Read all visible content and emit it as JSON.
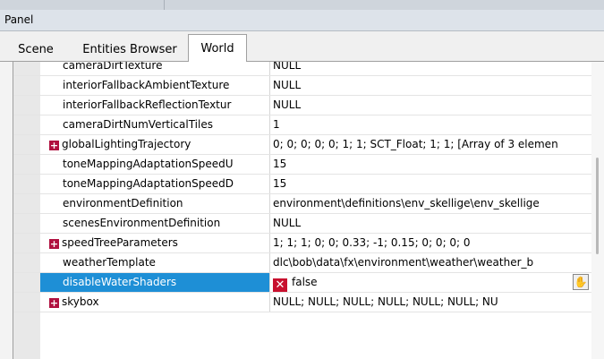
{
  "panel": {
    "title": "Panel"
  },
  "tabs": [
    {
      "label": "Scene"
    },
    {
      "label": "Entities Browser"
    },
    {
      "label": "World",
      "active": true
    }
  ],
  "properties": [
    {
      "name": "cameraDirtTexture",
      "value": "NULL",
      "expandable": false
    },
    {
      "name": "interiorFallbackAmbientTexture",
      "value": "NULL",
      "expandable": false
    },
    {
      "name": "interiorFallbackReflectionTextur",
      "value": "NULL",
      "expandable": false
    },
    {
      "name": "cameraDirtNumVerticalTiles",
      "value": "1",
      "expandable": false
    },
    {
      "name": "globalLightingTrajectory",
      "value": "0; 0; 0; 0; 0; 1; 1; SCT_Float; 1; 1; [Array of 3 elemen",
      "expandable": true
    },
    {
      "name": "toneMappingAdaptationSpeedU",
      "value": "15",
      "expandable": false
    },
    {
      "name": "toneMappingAdaptationSpeedD",
      "value": "15",
      "expandable": false
    },
    {
      "name": "environmentDefinition",
      "value": "environment\\definitions\\env_skellige\\env_skellige",
      "expandable": false
    },
    {
      "name": "scenesEnvironmentDefinition",
      "value": "NULL",
      "expandable": false
    },
    {
      "name": "speedTreeParameters",
      "value": "1; 1; 1; 0; 0; 0.33; -1; 0.15; 0; 0; 0; 0",
      "expandable": true
    },
    {
      "name": "weatherTemplate",
      "value": "dlc\\bob\\data\\fx\\environment\\weather\\weather_b",
      "expandable": false
    },
    {
      "name": "disableWaterShaders",
      "value": "false",
      "expandable": false,
      "selected": true
    },
    {
      "name": "skybox",
      "value": "NULL; NULL; NULL; NULL; NULL; NULL; NU",
      "expandable": true
    }
  ],
  "icons": {
    "expand": "plus-box-icon",
    "bool_false": "red-x-icon",
    "pick": "hand-icon"
  },
  "colors": {
    "selection": "#1e8fd6",
    "expand_box": "#b0103f",
    "false_box": "#c8102e"
  }
}
